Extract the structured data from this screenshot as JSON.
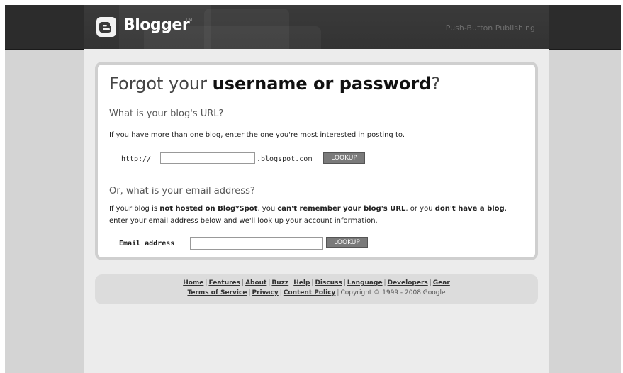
{
  "header": {
    "logo_text": "Blogger",
    "logo_tm": "TM",
    "tagline": "Push-Button Publishing"
  },
  "card": {
    "title_prefix": "Forgot your ",
    "title_bold": "username or password",
    "title_suffix": "?",
    "url_section": {
      "heading": "What is your blog's URL?",
      "help": "If you have more than one blog, enter the one you're most interested in posting to.",
      "prefix": "http://",
      "input_value": "",
      "suffix": ".blogspot.com",
      "button": "LOOKUP"
    },
    "email_section": {
      "heading": "Or, what is your email address?",
      "help": {
        "t1": "If your blog is ",
        "b1": "not hosted on Blog*Spot",
        "t2": ", you ",
        "b2": "can't remember your blog's URL",
        "t3": ", or you ",
        "b3": "don't have a blog",
        "t4": ", enter your email address below and we'll look up your account information."
      },
      "label": "Email address",
      "input_value": "",
      "button": "LOOKUP"
    }
  },
  "footer": {
    "links_row1": [
      "Home",
      "Features",
      "About",
      "Buzz",
      "Help",
      "Discuss",
      "Language",
      "Developers",
      "Gear"
    ],
    "links_row2": [
      "Terms of Service",
      "Privacy",
      "Content Policy"
    ],
    "copyright": "Copyright © 1999 - 2008 Google",
    "separator": "|"
  },
  "colors": {
    "header_bg": "#2c2c2c",
    "page_bg": "#d4d4d4",
    "button_bg": "#7a7a7a"
  }
}
